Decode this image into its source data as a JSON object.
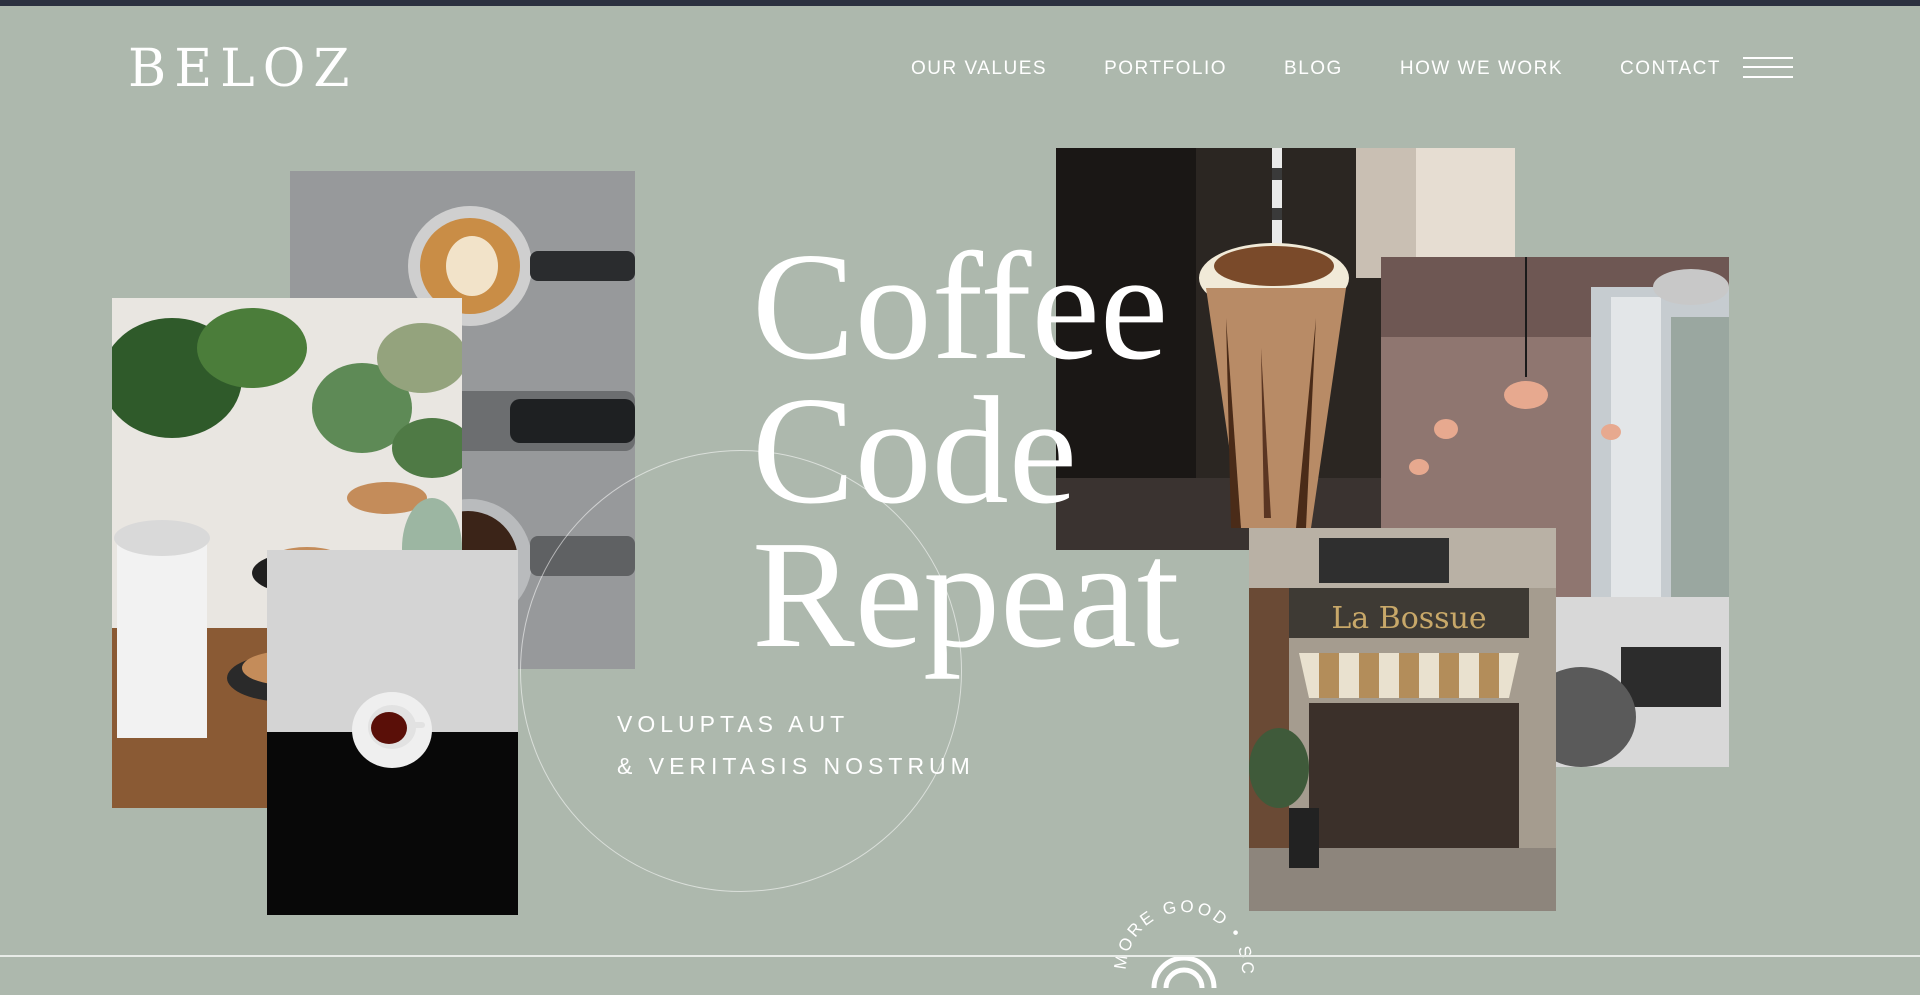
{
  "brand": {
    "logo_text": "BELOZ"
  },
  "nav": {
    "items": [
      {
        "label": "OUR VALUES"
      },
      {
        "label": "PORTFOLIO"
      },
      {
        "label": "BLOG"
      },
      {
        "label": "HOW WE WORK"
      },
      {
        "label": "CONTACT"
      }
    ],
    "menu_icon": "hamburger-menu-icon"
  },
  "hero": {
    "headline": [
      "Coffee",
      "Code",
      "Repeat"
    ],
    "tagline": [
      "VOLUPTAS AUT",
      "& VERITASIS NOSTRUM"
    ]
  },
  "scroll_badge": {
    "text": "MORE GOOD • SCROLL"
  },
  "photos": [
    {
      "subject": "latte art portafilters"
    },
    {
      "subject": "plants and cappuccinos"
    },
    {
      "subject": "espresso cup on black and white"
    },
    {
      "subject": "iced mocha frappe"
    },
    {
      "subject": "cafe window with pendant lights and laptop"
    },
    {
      "subject": "paris cafe storefront"
    }
  ],
  "colors": {
    "background": "#adb8ad",
    "topbar": "#2c3140",
    "text": "#ffffff"
  }
}
